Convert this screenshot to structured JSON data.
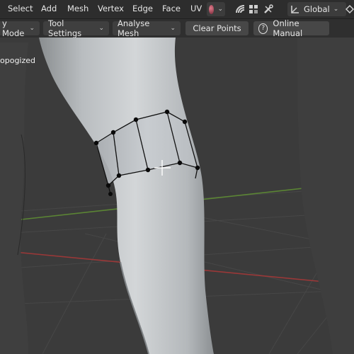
{
  "header": {
    "menus": [
      "Select",
      "Add",
      "Mesh",
      "Vertex",
      "Edge",
      "Face",
      "UV"
    ],
    "transform_orientation": "Global"
  },
  "toolbar": {
    "mode_label": "y Mode",
    "tool_settings_label": "Tool Settings",
    "analyse_mesh_label": "Analyse Mesh",
    "clear_points_label": "Clear Points",
    "online_manual_label": "Online Manual"
  },
  "viewport": {
    "object_label": "opogized"
  },
  "colors": {
    "x_axis": "#b03a3a",
    "y_axis": "#5a8a32",
    "grid": "#4a4a4a",
    "mesh_surface": "#c8cccf"
  },
  "icons": [
    "shading-sphere-icon",
    "xray-icon",
    "gizmo-icon",
    "tools-icon",
    "orientation-icon",
    "help-circle-icon",
    "cursor-crosshair-icon"
  ]
}
